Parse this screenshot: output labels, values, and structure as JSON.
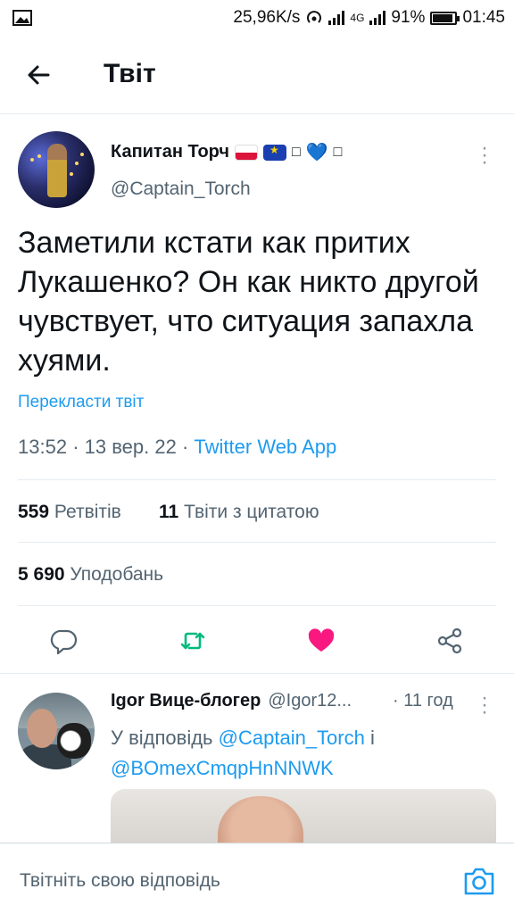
{
  "status_bar": {
    "speed": "25,96K/s",
    "network": "4G",
    "battery": "91%",
    "time": "01:45",
    "battery_level": 0.91,
    "icons": [
      "image-icon",
      "hotspot-icon",
      "signal-icon",
      "battery-icon"
    ]
  },
  "header": {
    "title": "Твіт",
    "back_icon": "arrow-left-icon"
  },
  "tweet": {
    "author_name": "Капитан Торч",
    "author_handle": "@Captain_Torch",
    "name_emojis": [
      "flag-poland",
      "flag-eu",
      "box-glyph",
      "blue-heart",
      "box-glyph"
    ],
    "box_glyph": "□",
    "heart": "💙",
    "text": "Заметили кстати как притих Лукашенко? Он как никто другой чувствует, что ситуация запахла хуями.",
    "translate": "Перекласти твіт",
    "time": "13:52",
    "date": "13 вер. 22",
    "separator": "·",
    "source": "Twitter Web App",
    "retweets_count": "559",
    "retweets_label": "Ретвітів",
    "quotes_count": "11",
    "quotes_label": "Твіти з цитатою",
    "likes_count": "5 690",
    "likes_label": "Уподобань",
    "actions": [
      "reply-icon",
      "retweet-icon",
      "like-icon",
      "share-icon"
    ],
    "colors": {
      "retweet": "#00ba7c",
      "like": "#f91880",
      "link": "#1d9bf0"
    }
  },
  "reply": {
    "author_name": "Igor Вице-блогер",
    "author_handle": "@Igor12...",
    "time": "· 11 год",
    "reply_prefix": "У відповідь",
    "mention1": "@Captain_Torch",
    "joiner": "і",
    "mention2": "@BOmexCmqpHnNNWK"
  },
  "composer": {
    "placeholder": "Твітніть свою відповідь",
    "camera_icon": "camera-icon"
  }
}
